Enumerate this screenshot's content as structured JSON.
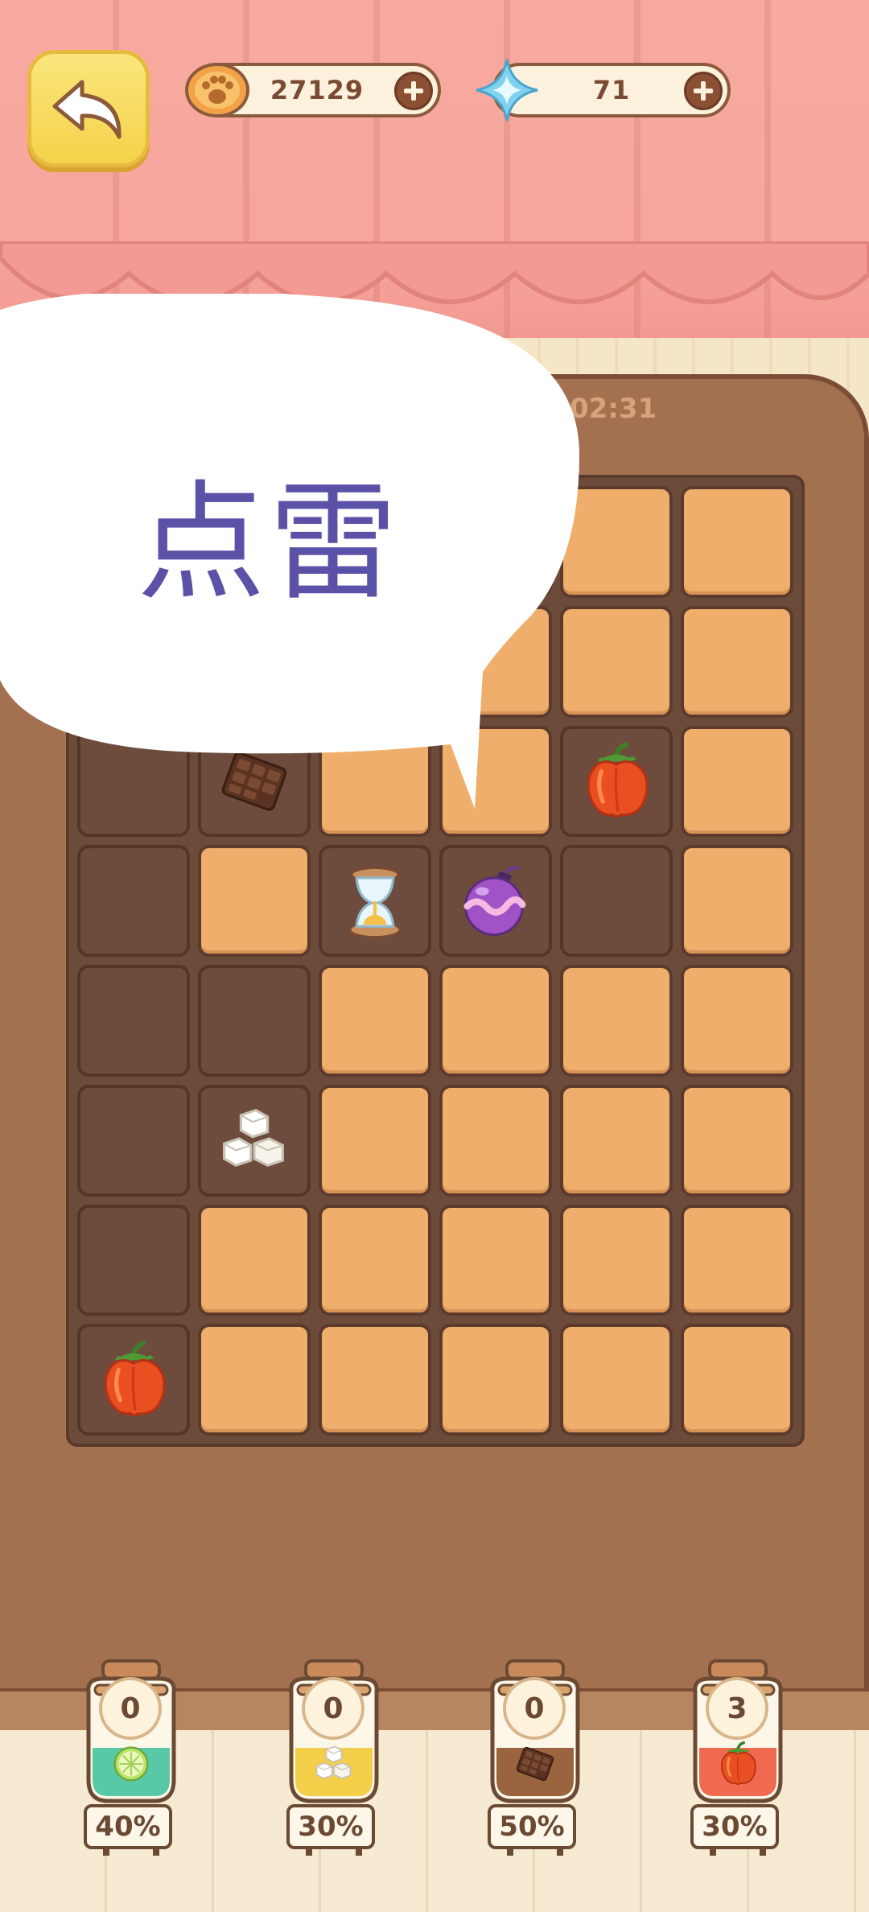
{
  "hud": {
    "coins": "27129",
    "gems": "71",
    "timer": "02:31"
  },
  "tutorial": {
    "bubble_text": "点雷"
  },
  "board": {
    "columns": 6,
    "rows": 8,
    "cells": [
      [
        "hidden",
        "hidden",
        "hidden",
        "hidden",
        "covered",
        "covered"
      ],
      [
        "hidden",
        "hidden",
        "hidden",
        "hidden",
        "covered",
        "covered"
      ],
      [
        "open",
        "chocolate",
        "covered",
        "covered",
        "bell-pepper",
        "covered"
      ],
      [
        "open",
        "covered",
        "hourglass",
        "purple-bomb",
        "open",
        "covered"
      ],
      [
        "open",
        "open",
        "covered",
        "covered",
        "covered",
        "covered"
      ],
      [
        "open",
        "sugar-cubes",
        "covered",
        "covered",
        "covered",
        "covered"
      ],
      [
        "open",
        "covered",
        "covered",
        "covered",
        "covered",
        "covered"
      ],
      [
        "bell-pepper",
        "covered",
        "covered",
        "covered",
        "covered",
        "covered"
      ]
    ]
  },
  "jars": [
    {
      "item": "lime",
      "count": "0",
      "percent": "40%",
      "liquid": "#58c9a7"
    },
    {
      "item": "sugar-cubes",
      "count": "0",
      "percent": "30%",
      "liquid": "#f4cf4a"
    },
    {
      "item": "chocolate",
      "count": "0",
      "percent": "50%",
      "liquid": "#9a643e"
    },
    {
      "item": "bell-pepper",
      "count": "3",
      "percent": "30%",
      "liquid": "#ef6a50"
    }
  ],
  "colors": {
    "curtain": "#f7a9a0",
    "panel": "#a3714f",
    "tile": "#efae6b",
    "bubble_text": "#5b52a8",
    "back_button": "#f4d24a"
  }
}
